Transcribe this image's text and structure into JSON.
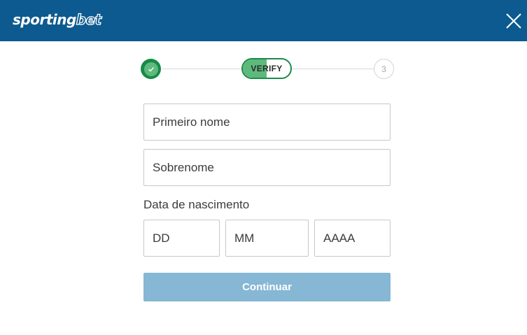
{
  "header": {
    "logo_part1": "sporting",
    "logo_part2": "bet",
    "close_icon": "close-icon",
    "background": "#0c5a8f"
  },
  "stepper": {
    "step1_icon": "check-icon",
    "step2_label": "VERIFY",
    "step3_label": "3",
    "done_color": "#168b47",
    "active_color": "#5dba7c"
  },
  "form": {
    "first_name_placeholder": "Primeiro nome",
    "last_name_placeholder": "Sobrenome",
    "dob_label": "Data de nascimento",
    "day_placeholder": "DD",
    "month_placeholder": "MM",
    "year_placeholder": "AAAA",
    "submit_label": "Continuar",
    "submit_color": "#86b7d4"
  }
}
